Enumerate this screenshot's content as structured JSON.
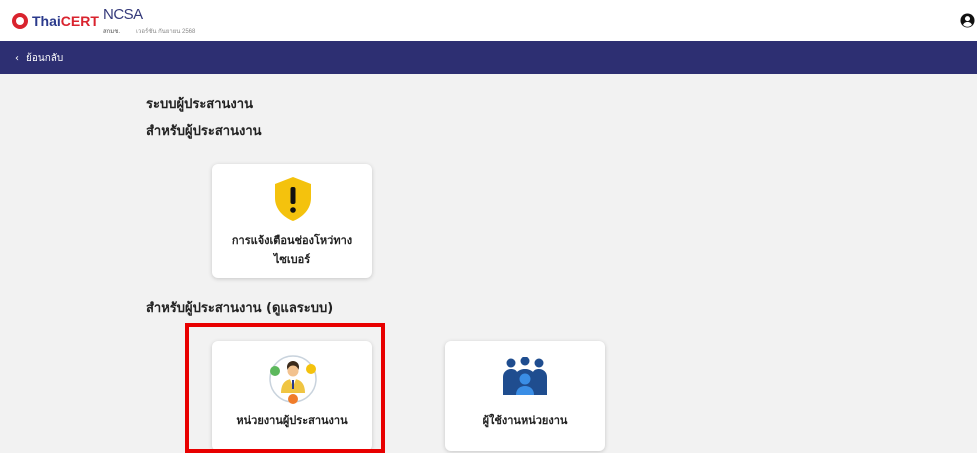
{
  "header": {
    "logo_thaicert": {
      "prefix": "Thai",
      "brand": "CERT"
    },
    "logo_ncsa": {
      "acronym": "NCSA",
      "tagline": "สกมช.",
      "version": "เวอร์ชัน กันยายน 2568"
    },
    "user_icon": "user-circle-icon"
  },
  "nav": {
    "back_label": "ย้อนกลับ"
  },
  "page": {
    "title": "ระบบผู้ประสานงาน",
    "section1": "สำหรับผู้ประสานงาน",
    "section2": "สำหรับผู้ประสานงาน (ดูแลระบบ)",
    "cards": [
      {
        "label": "การแจ้งเตือนช่องโหว่ทางไซเบอร์",
        "icon": "warning-shield-icon"
      },
      {
        "label": "หน่วยงานผู้ประสานงาน",
        "icon": "coordinator-icon"
      },
      {
        "label": "ผู้ใช้งานหน่วยงาน",
        "icon": "users-group-icon"
      }
    ]
  },
  "colors": {
    "navbar": "#2d2f72",
    "shield": "#f4c20d",
    "highlight": "#e80000",
    "users": "#1f4d8f"
  }
}
